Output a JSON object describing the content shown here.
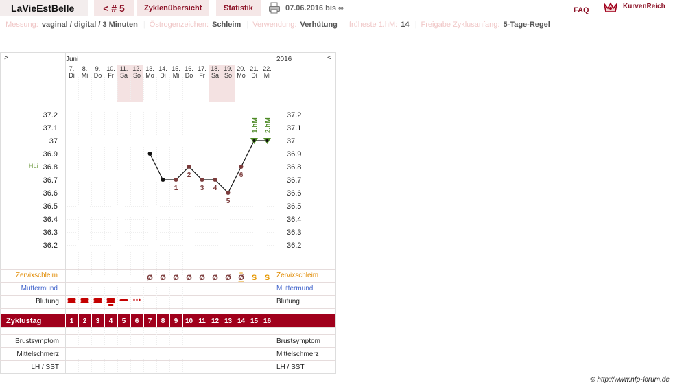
{
  "header": {
    "app_name": "LaVieEstBelle",
    "cycle_label": "< # 5",
    "tab_overview": "Zyklenübersicht",
    "tab_stats": "Statistik",
    "date_range": "07.06.2016 bis ∞",
    "faq": "FAQ",
    "brand": "KurvenReich"
  },
  "meta": {
    "measure_label": "Messung:",
    "measure_value": "vaginal / digital / 3 Minuten",
    "estrogen_label": "Östrogenzeichen:",
    "estrogen_value": "Schleim",
    "usage_label": "Verwendung:",
    "usage_value": "Verhütung",
    "earliest_label": "früheste 1.hM:",
    "earliest_value": "14",
    "release_label": "Freigabe Zyklusanfang:",
    "release_value": "5-Tage-Regel"
  },
  "chart_data": {
    "type": "line",
    "nav_prev": ">",
    "nav_next": "<",
    "month": "Juni",
    "year": "2016",
    "days": [
      {
        "date": "7.",
        "weekday": "Di",
        "weekend": false,
        "cycle_day": "1",
        "mucus": "",
        "bleed": "heavy"
      },
      {
        "date": "8.",
        "weekday": "Mi",
        "weekend": false,
        "cycle_day": "2",
        "mucus": "",
        "bleed": "heavy"
      },
      {
        "date": "9.",
        "weekday": "Do",
        "weekend": false,
        "cycle_day": "3",
        "mucus": "",
        "bleed": "heavy"
      },
      {
        "date": "10.",
        "weekday": "Fr",
        "weekend": false,
        "cycle_day": "4",
        "mucus": "",
        "bleed": "very heavy"
      },
      {
        "date": "11.",
        "weekday": "Sa",
        "weekend": true,
        "cycle_day": "5",
        "mucus": "",
        "bleed": "medium"
      },
      {
        "date": "12.",
        "weekday": "So",
        "weekend": true,
        "cycle_day": "6",
        "mucus": "",
        "bleed": "spotting"
      },
      {
        "date": "13.",
        "weekday": "Mo",
        "weekend": false,
        "cycle_day": "7",
        "mucus": "Ø",
        "bleed": ""
      },
      {
        "date": "14.",
        "weekday": "Di",
        "weekend": false,
        "cycle_day": "8",
        "mucus": "Ø",
        "bleed": ""
      },
      {
        "date": "15.",
        "weekday": "Mi",
        "weekend": false,
        "cycle_day": "9",
        "mucus": "Ø",
        "bleed": ""
      },
      {
        "date": "16.",
        "weekday": "Do",
        "weekend": false,
        "cycle_day": "10",
        "mucus": "Ø",
        "bleed": ""
      },
      {
        "date": "17.",
        "weekday": "Fr",
        "weekend": false,
        "cycle_day": "11",
        "mucus": "Ø",
        "bleed": ""
      },
      {
        "date": "18.",
        "weekday": "Sa",
        "weekend": true,
        "cycle_day": "12",
        "mucus": "Ø",
        "bleed": ""
      },
      {
        "date": "19.",
        "weekday": "So",
        "weekend": true,
        "cycle_day": "13",
        "mucus": "Ø",
        "bleed": ""
      },
      {
        "date": "20.",
        "weekday": "Mo",
        "weekend": false,
        "cycle_day": "14",
        "mucus": "Ø",
        "bleed": ""
      },
      {
        "date": "21.",
        "weekday": "Di",
        "weekend": false,
        "cycle_day": "15",
        "mucus": "S",
        "bleed": ""
      },
      {
        "date": "22.",
        "weekday": "Mi",
        "weekend": false,
        "cycle_day": "16",
        "mucus": "S",
        "bleed": ""
      }
    ],
    "mucus_peak_index": 13,
    "mucus_peak_text": "S",
    "mucus_peak_mark": "+",
    "temperatures": [
      null,
      null,
      null,
      null,
      null,
      null,
      36.9,
      36.7,
      36.7,
      36.8,
      36.7,
      36.7,
      36.6,
      36.8,
      37.0,
      37.0
    ],
    "lower_labels": {
      "8": "1",
      "9": "2",
      "10": "3",
      "11": "4",
      "12": "5",
      "13": "6"
    },
    "high_markers": [
      {
        "index": 14,
        "label": "1.hM"
      },
      {
        "index": 15,
        "label": "2.hM"
      }
    ],
    "coverline": {
      "value": 36.8,
      "label": "HLi"
    },
    "y_ticks": [
      "37.2",
      "37.1",
      "37",
      "36.9",
      "36.8",
      "36.7",
      "36.6",
      "36.5",
      "36.4",
      "36.3",
      "36.2"
    ],
    "y_values": [
      37.2,
      37.1,
      37.0,
      36.9,
      36.8,
      36.7,
      36.6,
      36.5,
      36.4,
      36.3,
      36.2
    ],
    "row_labels": {
      "mucus": "Zervixschleim",
      "cervix": "Muttermund",
      "bleeding": "Blutung",
      "cycle_day": "Zyklustag",
      "breast": "Brustsymptom",
      "midpain": "Mittelschmerz",
      "lh": "LH / SST"
    },
    "colors": {
      "accent": "#a0001c",
      "coverline": "#7fa657",
      "high": "#4d8a26",
      "point": "#7b3b3b",
      "mucus_s": "#e69800",
      "mucus_label": "#e08a00",
      "cervix_label": "#4466cc",
      "weekend": "#f4e2e2",
      "bleed": "#c40000"
    }
  },
  "footer": {
    "copyright": "© http://www.nfp-forum.de"
  }
}
